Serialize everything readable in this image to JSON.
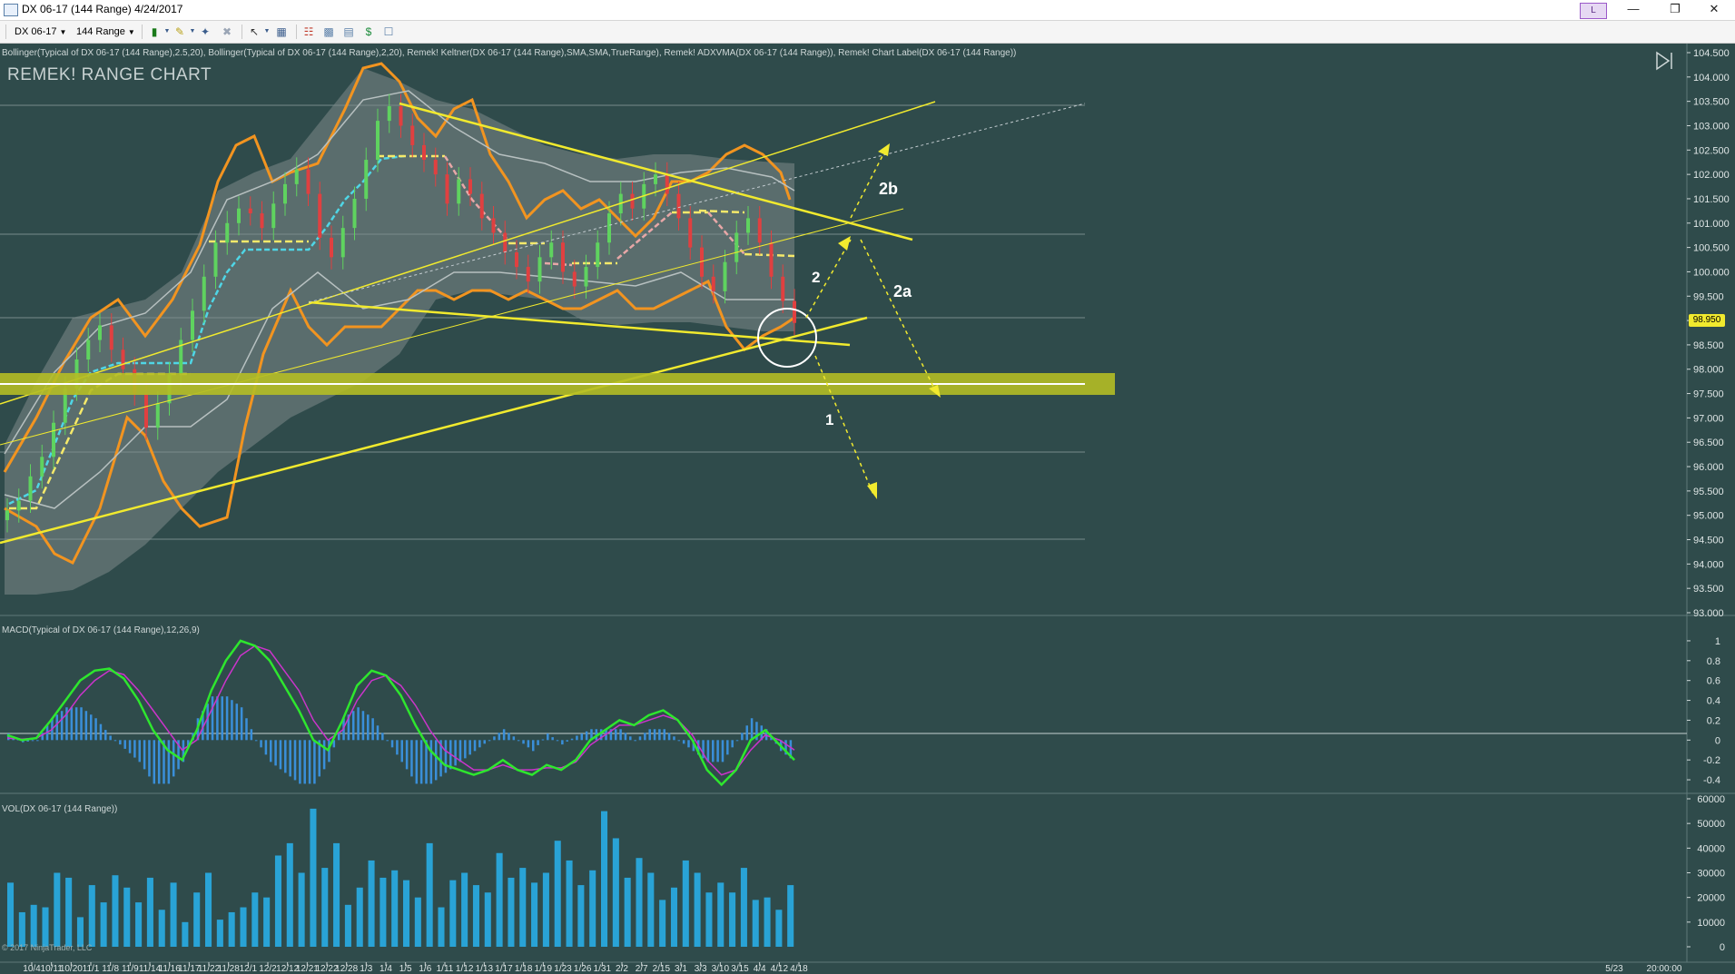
{
  "window": {
    "title": "DX 06-17 (144 Range)  4/24/2017",
    "link_button": "L",
    "minimize_icon": "minimize-icon",
    "restore_icon": "restore-icon",
    "close_icon": "close-icon"
  },
  "toolbar": {
    "instrument": "DX 06-17",
    "interval": "144 Range"
  },
  "indicators": {
    "price_panel": "Bollinger(Typical of DX 06-17 (144 Range),2.5,20), Bollinger(Typical of DX 06-17 (144 Range),2,20), Remek! Keltner(DX 06-17 (144 Range),SMA,SMA,TrueRange), Remek! ADXVMA(DX 06-17 (144 Range)), Remek! Chart Label(DX 06-17 (144 Range))",
    "macd_panel": "MACD(Typical of DX 06-17 (144 Range),12,26,9)",
    "volume_panel": "VOL(DX 06-17 (144 Range))"
  },
  "chart_label": "REMEK! RANGE CHART",
  "current_price": "98.950",
  "annotations": {
    "label_1": "1",
    "label_2": "2",
    "label_2a": "2a",
    "label_2b": "2b"
  },
  "copyright": "© 2017 NinjaTrader, LLC",
  "colors": {
    "background": "#2f4b4b",
    "trendline": "#f1ea2e",
    "bollinger": "#f29420",
    "macd": "#2ee62e",
    "signal": "#cc33cc",
    "histogram": "#3a8fd9",
    "volume": "#29a3d6"
  },
  "chart_data": [
    {
      "type": "candlestick",
      "panel": "price",
      "ylim": [
        93.0,
        104.5
      ],
      "y_ticks": [
        "104.500",
        "104.000",
        "103.500",
        "103.000",
        "102.500",
        "102.000",
        "101.500",
        "101.000",
        "100.500",
        "100.000",
        "99.500",
        "99.000",
        "98.500",
        "98.000",
        "97.500",
        "97.000",
        "96.500",
        "96.000",
        "95.500",
        "95.000",
        "94.500",
        "94.000",
        "93.500",
        "93.000"
      ],
      "x_ticks": [
        "10/4",
        "10/11",
        "10/20",
        "11/1",
        "11/8",
        "11/9",
        "11/14",
        "11/16",
        "11/17",
        "11/22",
        "11/28",
        "12/1",
        "12/2",
        "12/12",
        "12/21",
        "12/22",
        "12/28",
        "1/3",
        "1/4",
        "1/5",
        "1/6",
        "1/11",
        "1/12",
        "1/13",
        "1/17",
        "1/18",
        "1/19",
        "1/23",
        "1/26",
        "1/31",
        "2/2",
        "2/7",
        "2/15",
        "3/1",
        "3/3",
        "3/10",
        "3/15",
        "4/4",
        "4/12",
        "4/18",
        "5/23",
        "20:00:00"
      ],
      "close": [
        95.1,
        95.3,
        95.8,
        96.2,
        96.9,
        97.6,
        98.2,
        98.6,
        98.9,
        98.4,
        98.0,
        97.5,
        96.8,
        97.3,
        97.9,
        98.6,
        99.2,
        99.9,
        100.6,
        101.0,
        101.3,
        101.2,
        100.9,
        101.4,
        101.8,
        102.1,
        101.6,
        100.7,
        100.3,
        100.9,
        101.5,
        102.3,
        103.1,
        103.4,
        103.0,
        102.6,
        102.3,
        102.0,
        101.4,
        101.9,
        101.6,
        101.1,
        100.8,
        100.4,
        100.1,
        99.8,
        100.3,
        100.6,
        100.0,
        99.7,
        100.1,
        100.6,
        101.2,
        101.6,
        101.3,
        101.8,
        102.0,
        101.6,
        101.1,
        100.5,
        99.9,
        99.6,
        100.2,
        100.8,
        101.1,
        100.6,
        99.9,
        99.4,
        98.95
      ]
    },
    {
      "type": "line",
      "panel": "macd",
      "ylim": [
        -0.5,
        1.1
      ],
      "y_ticks": [
        "1",
        "0.8",
        "0.6",
        "0.4",
        "0.2",
        "0",
        "-0.2",
        "-0.4"
      ],
      "series": [
        {
          "name": "MACD",
          "values": [
            0.05,
            0.0,
            0.02,
            0.2,
            0.4,
            0.6,
            0.7,
            0.72,
            0.62,
            0.4,
            0.1,
            -0.1,
            -0.2,
            0.1,
            0.5,
            0.8,
            1.0,
            0.95,
            0.8,
            0.55,
            0.3,
            0.0,
            -0.1,
            0.2,
            0.55,
            0.7,
            0.65,
            0.45,
            0.15,
            -0.1,
            -0.25,
            -0.3,
            -0.35,
            -0.3,
            -0.2,
            -0.3,
            -0.35,
            -0.25,
            -0.3,
            -0.2,
            0.0,
            0.1,
            0.2,
            0.15,
            0.25,
            0.3,
            0.2,
            0.0,
            -0.3,
            -0.45,
            -0.3,
            0.0,
            0.1,
            -0.05,
            -0.2
          ]
        },
        {
          "name": "Signal",
          "values": [
            0.02,
            0.01,
            0.02,
            0.1,
            0.25,
            0.45,
            0.6,
            0.7,
            0.66,
            0.5,
            0.3,
            0.1,
            -0.1,
            0.0,
            0.3,
            0.6,
            0.85,
            0.95,
            0.9,
            0.7,
            0.5,
            0.2,
            0.0,
            0.1,
            0.4,
            0.6,
            0.65,
            0.55,
            0.35,
            0.1,
            -0.1,
            -0.2,
            -0.3,
            -0.3,
            -0.25,
            -0.3,
            -0.3,
            -0.28,
            -0.28,
            -0.22,
            -0.05,
            0.05,
            0.15,
            0.15,
            0.2,
            0.25,
            0.2,
            0.05,
            -0.2,
            -0.35,
            -0.3,
            -0.1,
            0.05,
            0.0,
            -0.1
          ]
        }
      ]
    },
    {
      "type": "bar",
      "panel": "volume",
      "ylim": [
        0,
        60000
      ],
      "y_ticks": [
        "60000",
        "50000",
        "40000",
        "30000",
        "20000",
        "10000",
        "0"
      ],
      "values": [
        26000,
        14000,
        17000,
        16000,
        30000,
        28000,
        12000,
        25000,
        18000,
        29000,
        24000,
        18000,
        28000,
        15000,
        26000,
        10000,
        22000,
        30000,
        11000,
        14000,
        16000,
        22000,
        20000,
        37000,
        42000,
        30000,
        56000,
        32000,
        42000,
        17000,
        24000,
        35000,
        28000,
        31000,
        27000,
        20000,
        42000,
        16000,
        27000,
        30000,
        25000,
        22000,
        38000,
        28000,
        32000,
        26000,
        30000,
        43000,
        35000,
        25000,
        31000,
        55000,
        44000,
        28000,
        36000,
        30000,
        19000,
        24000,
        35000,
        30000,
        22000,
        26000,
        22000,
        32000,
        19000,
        20000,
        15000,
        25000
      ]
    }
  ]
}
